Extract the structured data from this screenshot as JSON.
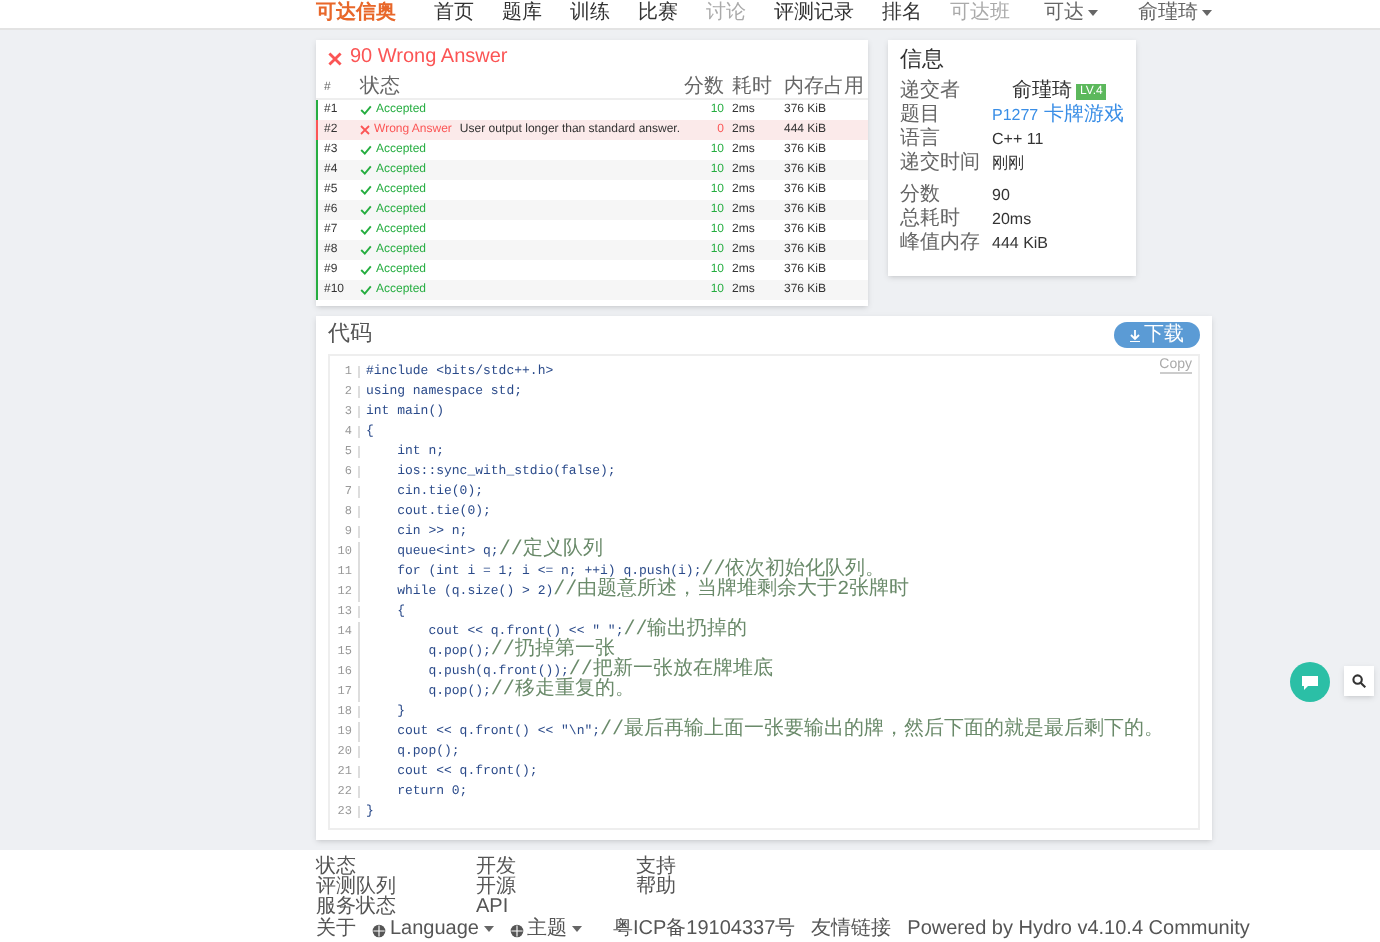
{
  "nav": {
    "logo": "可达信奥",
    "items": [
      {
        "label": "首页",
        "dim": false
      },
      {
        "label": "题库",
        "dim": false
      },
      {
        "label": "训练",
        "dim": false
      },
      {
        "label": "比赛",
        "dim": false
      },
      {
        "label": "讨论",
        "dim": true
      },
      {
        "label": "评测记录",
        "dim": false
      },
      {
        "label": "排名",
        "dim": false
      },
      {
        "label": "可达班",
        "dim": true
      }
    ],
    "right": [
      "可达",
      "俞瑾琦"
    ]
  },
  "result": {
    "title": "90 Wrong Answer",
    "columns": [
      "#",
      "状态",
      "分数",
      "耗时",
      "内存占用"
    ],
    "rows": [
      {
        "id": "#1",
        "kind": "accepted",
        "status": "Accepted",
        "message": "",
        "score": "10",
        "time": "2ms",
        "memory": "376 KiB"
      },
      {
        "id": "#2",
        "kind": "wrong",
        "status": "Wrong Answer",
        "message": "User output longer than standard answer.",
        "score": "0",
        "time": "2ms",
        "memory": "444 KiB"
      },
      {
        "id": "#3",
        "kind": "accepted",
        "status": "Accepted",
        "message": "",
        "score": "10",
        "time": "2ms",
        "memory": "376 KiB"
      },
      {
        "id": "#4",
        "kind": "accepted",
        "status": "Accepted",
        "message": "",
        "score": "10",
        "time": "2ms",
        "memory": "376 KiB"
      },
      {
        "id": "#5",
        "kind": "accepted",
        "status": "Accepted",
        "message": "",
        "score": "10",
        "time": "2ms",
        "memory": "376 KiB"
      },
      {
        "id": "#6",
        "kind": "accepted",
        "status": "Accepted",
        "message": "",
        "score": "10",
        "time": "2ms",
        "memory": "376 KiB"
      },
      {
        "id": "#7",
        "kind": "accepted",
        "status": "Accepted",
        "message": "",
        "score": "10",
        "time": "2ms",
        "memory": "376 KiB"
      },
      {
        "id": "#8",
        "kind": "accepted",
        "status": "Accepted",
        "message": "",
        "score": "10",
        "time": "2ms",
        "memory": "376 KiB"
      },
      {
        "id": "#9",
        "kind": "accepted",
        "status": "Accepted",
        "message": "",
        "score": "10",
        "time": "2ms",
        "memory": "376 KiB"
      },
      {
        "id": "#10",
        "kind": "accepted",
        "status": "Accepted",
        "message": "",
        "score": "10",
        "time": "2ms",
        "memory": "376 KiB"
      }
    ]
  },
  "info": {
    "title": "信息",
    "groups": [
      [
        {
          "label": "递交者",
          "kind": "user",
          "value": "俞瑾琦",
          "badge": "LV.4"
        },
        {
          "label": "题目",
          "kind": "link",
          "value": "P1277",
          "extra": "卡牌游戏"
        },
        {
          "label": "语言",
          "kind": "text",
          "value": "C++ 11"
        },
        {
          "label": "递交时间",
          "kind": "text",
          "value": "刚刚"
        }
      ],
      [
        {
          "label": "分数",
          "kind": "text",
          "value": "90"
        },
        {
          "label": "总耗时",
          "kind": "text",
          "value": "20ms"
        },
        {
          "label": "峰值内存",
          "kind": "text",
          "value": "444 KiB"
        }
      ]
    ]
  },
  "code": {
    "title": "代码",
    "download": "下载",
    "copy": "Copy",
    "lines": [
      {
        "number": "1",
        "code": "#include <bits/stdc++.h>"
      },
      {
        "number": "2",
        "code": "using namespace std;"
      },
      {
        "number": "3",
        "code": "int main()"
      },
      {
        "number": "4",
        "code": "{"
      },
      {
        "number": "5",
        "code": "    int n;"
      },
      {
        "number": "6",
        "code": "    ios::sync_with_stdio(false);"
      },
      {
        "number": "7",
        "code": "    cin.tie(0);"
      },
      {
        "number": "8",
        "code": "    cout.tie(0);"
      },
      {
        "number": "9",
        "code": "    cin >> n;"
      },
      {
        "number": "10",
        "code": "    queue<int> q;",
        "comment": "//定义队列"
      },
      {
        "number": "11",
        "code": "    for (int i = 1; i <= n; ++i) q.push(i);",
        "comment": "//依次初始化队列。"
      },
      {
        "number": "12",
        "code": "    while (q.size() > 2)",
        "comment": "//由题意所述，当牌堆剩余大于2张牌时"
      },
      {
        "number": "13",
        "code": "    {"
      },
      {
        "number": "14",
        "code": "        cout << q.front() << \" \";",
        "comment": "//输出扔掉的"
      },
      {
        "number": "15",
        "code": "        q.pop();",
        "comment": "//扔掉第一张"
      },
      {
        "number": "16",
        "code": "        q.push(q.front());",
        "comment": "//把新一张放在牌堆底"
      },
      {
        "number": "17",
        "code": "        q.pop();",
        "comment": "//移走重复的。"
      },
      {
        "number": "18",
        "code": "    }"
      },
      {
        "number": "19",
        "code": "    cout << q.front() << \"\\n\";",
        "comment": "//最后再输上面一张要输出的牌，然后下面的就是最后剩下的。"
      },
      {
        "number": "20",
        "code": "    q.pop();"
      },
      {
        "number": "21",
        "code": "    cout << q.front();"
      },
      {
        "number": "22",
        "code": "    return 0;"
      },
      {
        "number": "23",
        "code": "}"
      }
    ]
  },
  "footer": {
    "columns": [
      {
        "title": "状态",
        "links": [
          "评测队列",
          "服务状态"
        ]
      },
      {
        "title": "开发",
        "links": [
          "开源",
          "API"
        ]
      },
      {
        "title": "支持",
        "links": [
          "帮助"
        ]
      }
    ],
    "left": [
      {
        "label": "关于",
        "menu": false
      },
      {
        "label": "Language",
        "menu": true
      },
      {
        "label": "主题",
        "menu": true
      }
    ],
    "right": [
      "粤ICP备19104337号",
      "友情链接",
      "Powered by Hydro v4.10.4 Community"
    ]
  }
}
